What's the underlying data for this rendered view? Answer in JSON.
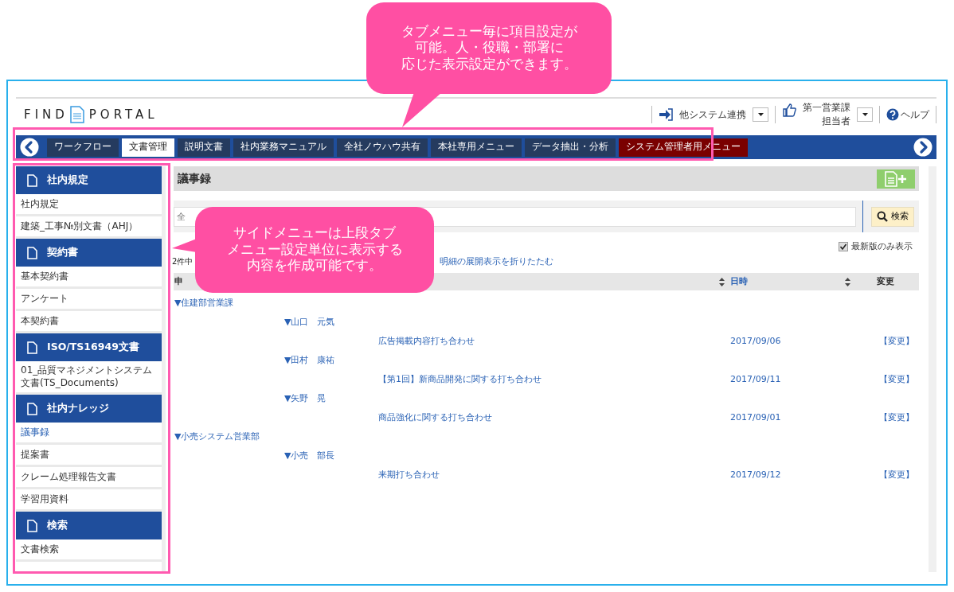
{
  "logo": {
    "left": "FIND",
    "right": "PORTAL"
  },
  "header": {
    "link_system": "他システム連携",
    "user": {
      "department": "第一営業課",
      "role": "担当者"
    },
    "help": "ヘルプ"
  },
  "tabs": [
    {
      "label": "ワークフロー",
      "selected": false,
      "kind": "normal"
    },
    {
      "label": "文書管理",
      "selected": true,
      "kind": "normal"
    },
    {
      "label": "説明文書",
      "selected": false,
      "kind": "normal"
    },
    {
      "label": "社内業務マニュアル",
      "selected": false,
      "kind": "normal"
    },
    {
      "label": "全社ノウハウ共有",
      "selected": false,
      "kind": "normal"
    },
    {
      "label": "本社専用メニュー",
      "selected": false,
      "kind": "normal"
    },
    {
      "label": "データ抽出・分析",
      "selected": false,
      "kind": "normal"
    },
    {
      "label": "システム管理者用メニュー",
      "selected": false,
      "kind": "admin"
    }
  ],
  "sidebar": {
    "sections": [
      {
        "title": "社内規定",
        "items": [
          {
            "label": "社内規定",
            "selected": false
          },
          {
            "label": "建築_工事№別文書（AHJ）",
            "selected": false
          }
        ]
      },
      {
        "title": "契約書",
        "items": [
          {
            "label": "基本契約書",
            "selected": false
          },
          {
            "label": "アンケート",
            "selected": false
          },
          {
            "label": "本契約書",
            "selected": false
          }
        ]
      },
      {
        "title": "ISO/TS16949文書",
        "items": [
          {
            "label": "01_品質マネジメントシステム文書(TS_Documents)",
            "selected": false
          }
        ]
      },
      {
        "title": "社内ナレッジ",
        "items": [
          {
            "label": "議事録",
            "selected": true
          },
          {
            "label": "提案書",
            "selected": false
          },
          {
            "label": "クレーム処理報告文書",
            "selected": false
          },
          {
            "label": "学習用資料",
            "selected": false
          }
        ]
      },
      {
        "title": "検索",
        "items": [
          {
            "label": "文書検索",
            "selected": false
          }
        ]
      }
    ]
  },
  "content": {
    "title": "議事録",
    "search": {
      "placeholder": "全",
      "button": "検索"
    },
    "latest_only": {
      "label": "最新版のみ表示",
      "checked": true
    },
    "pager": {
      "count": "2件中"
    },
    "collapse_all": "明細の展開表示を折りたたむ",
    "columns": [
      {
        "label": "申"
      },
      {
        "sortable": true
      },
      {
        "label": "日時",
        "sortable": true
      },
      {
        "label": "変更",
        "sortable": false
      }
    ],
    "groups": [
      {
        "department": "▼住建部営業課",
        "reporters": [
          {
            "name": "▼山口　元気",
            "rows": [
              {
                "subject": "広告掲載内容打ち合わせ",
                "date": "2017/09/06",
                "action": "【変更】"
              }
            ]
          },
          {
            "name": "▼田村　康祐",
            "rows": [
              {
                "subject": "【第1回】新商品開発に関する打ち合わせ",
                "date": "2017/09/11",
                "action": "【変更】"
              }
            ]
          },
          {
            "name": "▼矢野　晃",
            "rows": [
              {
                "subject": "商品強化に関する打ち合わせ",
                "date": "2017/09/01",
                "action": "【変更】"
              }
            ]
          }
        ]
      },
      {
        "department": "▼小売システム営業部",
        "reporters": [
          {
            "name": "▼小売　部長",
            "rows": [
              {
                "subject": "来期打ち合わせ",
                "date": "2017/09/12",
                "action": "【変更】"
              }
            ]
          }
        ]
      }
    ]
  },
  "callouts": [
    {
      "lines": [
        "タブメニュー毎に項目設定が",
        "可能。人・役職・部署に",
        "応じた表示設定ができます。"
      ]
    },
    {
      "lines": [
        "サイドメニューは上段タブ",
        "メニュー設定単位に表示する",
        "内容を作成可能です。"
      ]
    }
  ]
}
